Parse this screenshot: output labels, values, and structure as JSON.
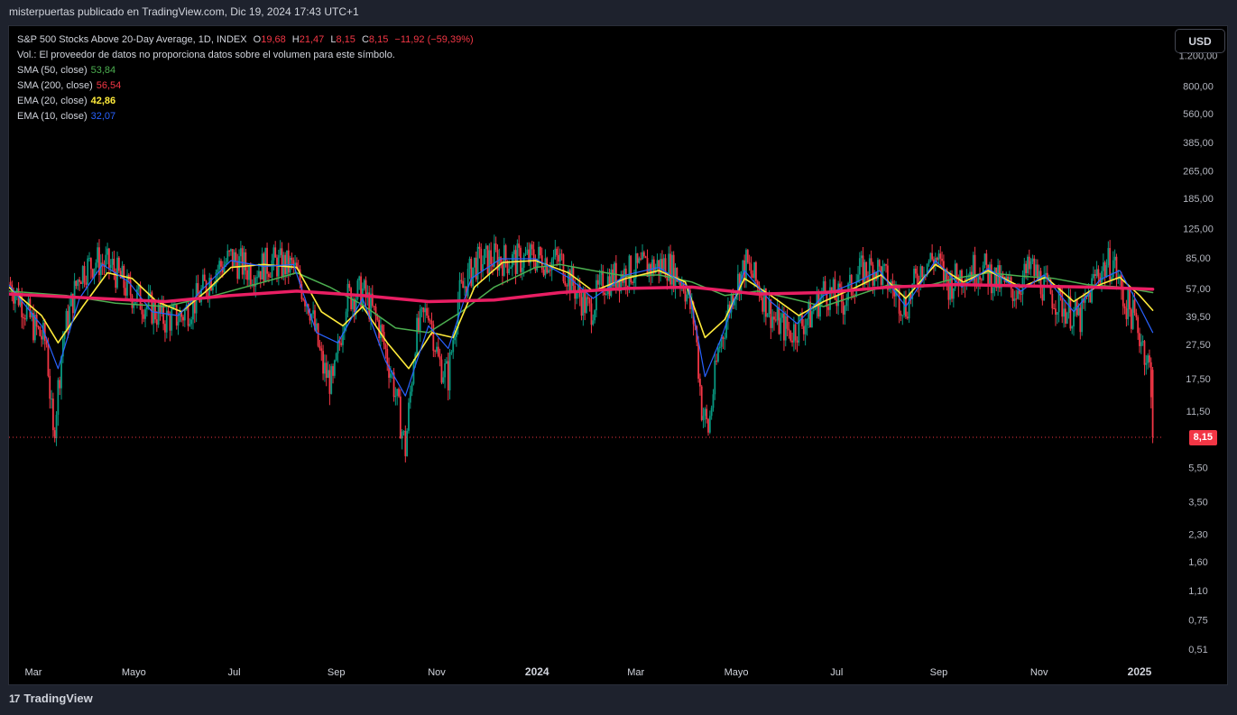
{
  "header": {
    "publish_line": "misterpuertas publicado en TradingView.com, Dic 19, 2024 17:43 UTC+1"
  },
  "footer": {
    "brand": "TradingView",
    "logo_glyph": "17"
  },
  "currency_button": "USD",
  "legend": {
    "symbol": "S&P 500 Stocks Above 20-Day Average, 1D, INDEX",
    "o_label": "O",
    "o_value": "19,68",
    "h_label": "H",
    "h_value": "21,47",
    "l_label": "L",
    "l_value": "8,15",
    "c_label": "C",
    "c_value": "8,15",
    "change": "−11,92 (−59,39%)",
    "volume_note": "Vol.: El proveedor de datos no proporciona datos sobre el volumen para este símbolo.",
    "indicators": [
      {
        "label": "SMA (50, close)",
        "value": "53,84",
        "color": "#4caf50"
      },
      {
        "label": "SMA (200, close)",
        "value": "56,54",
        "color": "#f23645"
      },
      {
        "label": "EMA (20, close)",
        "value": "42,86",
        "color": "#ffeb3b"
      },
      {
        "label": "EMA (10, close)",
        "value": "32,07",
        "color": "#2962ff"
      }
    ]
  },
  "colors": {
    "up": "#089981",
    "down": "#f23645",
    "sma50": "#4caf50",
    "sma200": "#e91e63",
    "ema20": "#ffeb3b",
    "ema10": "#2962ff"
  },
  "current_price_label": "8,15",
  "chart_data": {
    "type": "candlestick",
    "scale": "log",
    "title": "S&P 500 Stocks Above 20-Day Average, 1D, INDEX",
    "y_ticks": [
      "1.200,00",
      "800,00",
      "560,00",
      "385,00",
      "265,00",
      "185,00",
      "125,00",
      "85,00",
      "57,00",
      "39,50",
      "27,50",
      "17,50",
      "11,50",
      "8,15",
      "5,50",
      "3,50",
      "2,30",
      "1,60",
      "1,10",
      "0,75",
      "0,51"
    ],
    "y_tick_values": [
      1200,
      800,
      560,
      385,
      265,
      185,
      125,
      85,
      57,
      39.5,
      27.5,
      17.5,
      11.5,
      8.15,
      5.5,
      3.5,
      2.3,
      1.6,
      1.1,
      0.75,
      0.51
    ],
    "ylim": [
      0.45,
      1500
    ],
    "x_ticks": [
      {
        "label": "Mar",
        "day": 0
      },
      {
        "label": "Mayo",
        "day": 61
      },
      {
        "label": "Jul",
        "day": 122
      },
      {
        "label": "Sep",
        "day": 184
      },
      {
        "label": "Nov",
        "day": 245
      },
      {
        "label": "2024",
        "day": 306
      },
      {
        "label": "Mar",
        "day": 366
      },
      {
        "label": "Mayo",
        "day": 427
      },
      {
        "label": "Jul",
        "day": 488
      },
      {
        "label": "Sep",
        "day": 550
      },
      {
        "label": "Nov",
        "day": 611
      },
      {
        "label": "2025",
        "day": 672
      }
    ],
    "x_range": [
      -15,
      700
    ],
    "close_series": [
      {
        "day": -15,
        "v": 62
      },
      {
        "day": -8,
        "v": 50
      },
      {
        "day": 0,
        "v": 35
      },
      {
        "day": 8,
        "v": 28
      },
      {
        "day": 12,
        "v": 8
      },
      {
        "day": 18,
        "v": 30
      },
      {
        "day": 28,
        "v": 70
      },
      {
        "day": 38,
        "v": 82
      },
      {
        "day": 48,
        "v": 75
      },
      {
        "day": 58,
        "v": 55
      },
      {
        "day": 70,
        "v": 45
      },
      {
        "day": 80,
        "v": 38
      },
      {
        "day": 90,
        "v": 40
      },
      {
        "day": 100,
        "v": 50
      },
      {
        "day": 110,
        "v": 72
      },
      {
        "day": 120,
        "v": 85
      },
      {
        "day": 132,
        "v": 72
      },
      {
        "day": 145,
        "v": 80
      },
      {
        "day": 158,
        "v": 75
      },
      {
        "day": 168,
        "v": 45
      },
      {
        "day": 176,
        "v": 20
      },
      {
        "day": 182,
        "v": 16
      },
      {
        "day": 190,
        "v": 50
      },
      {
        "day": 200,
        "v": 55
      },
      {
        "day": 210,
        "v": 35
      },
      {
        "day": 218,
        "v": 18
      },
      {
        "day": 226,
        "v": 7
      },
      {
        "day": 232,
        "v": 30
      },
      {
        "day": 240,
        "v": 45
      },
      {
        "day": 246,
        "v": 22
      },
      {
        "day": 252,
        "v": 18
      },
      {
        "day": 258,
        "v": 50
      },
      {
        "day": 268,
        "v": 78
      },
      {
        "day": 280,
        "v": 85
      },
      {
        "day": 292,
        "v": 82
      },
      {
        "day": 305,
        "v": 85
      },
      {
        "day": 320,
        "v": 82
      },
      {
        "day": 330,
        "v": 55
      },
      {
        "day": 338,
        "v": 42
      },
      {
        "day": 346,
        "v": 62
      },
      {
        "day": 360,
        "v": 70
      },
      {
        "day": 372,
        "v": 75
      },
      {
        "day": 385,
        "v": 78
      },
      {
        "day": 395,
        "v": 62
      },
      {
        "day": 402,
        "v": 35
      },
      {
        "day": 406,
        "v": 12
      },
      {
        "day": 410,
        "v": 9
      },
      {
        "day": 416,
        "v": 25
      },
      {
        "day": 425,
        "v": 55
      },
      {
        "day": 433,
        "v": 78
      },
      {
        "day": 442,
        "v": 55
      },
      {
        "day": 450,
        "v": 38
      },
      {
        "day": 460,
        "v": 32
      },
      {
        "day": 472,
        "v": 40
      },
      {
        "day": 480,
        "v": 55
      },
      {
        "day": 492,
        "v": 48
      },
      {
        "day": 502,
        "v": 70
      },
      {
        "day": 512,
        "v": 75
      },
      {
        "day": 520,
        "v": 60
      },
      {
        "day": 530,
        "v": 45
      },
      {
        "day": 540,
        "v": 78
      },
      {
        "day": 548,
        "v": 85
      },
      {
        "day": 556,
        "v": 60
      },
      {
        "day": 566,
        "v": 72
      },
      {
        "day": 576,
        "v": 75
      },
      {
        "day": 586,
        "v": 62
      },
      {
        "day": 596,
        "v": 55
      },
      {
        "day": 606,
        "v": 75
      },
      {
        "day": 616,
        "v": 55
      },
      {
        "day": 626,
        "v": 45
      },
      {
        "day": 636,
        "v": 38
      },
      {
        "day": 646,
        "v": 70
      },
      {
        "day": 656,
        "v": 82
      },
      {
        "day": 662,
        "v": 50
      },
      {
        "day": 668,
        "v": 40
      },
      {
        "day": 674,
        "v": 28
      },
      {
        "day": 678,
        "v": 20
      },
      {
        "day": 680,
        "v": 8.15
      }
    ],
    "sma50": [
      {
        "day": -15,
        "v": 55
      },
      {
        "day": 20,
        "v": 52
      },
      {
        "day": 50,
        "v": 47
      },
      {
        "day": 80,
        "v": 45
      },
      {
        "day": 110,
        "v": 52
      },
      {
        "day": 140,
        "v": 62
      },
      {
        "day": 160,
        "v": 70
      },
      {
        "day": 180,
        "v": 58
      },
      {
        "day": 200,
        "v": 46
      },
      {
        "day": 220,
        "v": 34
      },
      {
        "day": 240,
        "v": 32
      },
      {
        "day": 260,
        "v": 42
      },
      {
        "day": 280,
        "v": 58
      },
      {
        "day": 305,
        "v": 75
      },
      {
        "day": 320,
        "v": 78
      },
      {
        "day": 340,
        "v": 72
      },
      {
        "day": 360,
        "v": 67
      },
      {
        "day": 380,
        "v": 68
      },
      {
        "day": 400,
        "v": 62
      },
      {
        "day": 420,
        "v": 52
      },
      {
        "day": 440,
        "v": 55
      },
      {
        "day": 460,
        "v": 50
      },
      {
        "day": 480,
        "v": 45
      },
      {
        "day": 500,
        "v": 52
      },
      {
        "day": 520,
        "v": 60
      },
      {
        "day": 540,
        "v": 58
      },
      {
        "day": 560,
        "v": 65
      },
      {
        "day": 580,
        "v": 70
      },
      {
        "day": 600,
        "v": 67
      },
      {
        "day": 620,
        "v": 65
      },
      {
        "day": 640,
        "v": 60
      },
      {
        "day": 660,
        "v": 58
      },
      {
        "day": 680,
        "v": 54
      }
    ],
    "sma200": [
      {
        "day": -15,
        "v": 53
      },
      {
        "day": 40,
        "v": 50
      },
      {
        "day": 80,
        "v": 48
      },
      {
        "day": 120,
        "v": 52
      },
      {
        "day": 160,
        "v": 55
      },
      {
        "day": 200,
        "v": 52
      },
      {
        "day": 240,
        "v": 48
      },
      {
        "day": 280,
        "v": 49
      },
      {
        "day": 320,
        "v": 54
      },
      {
        "day": 360,
        "v": 57
      },
      {
        "day": 400,
        "v": 58
      },
      {
        "day": 440,
        "v": 53
      },
      {
        "day": 480,
        "v": 54
      },
      {
        "day": 520,
        "v": 58
      },
      {
        "day": 560,
        "v": 60
      },
      {
        "day": 600,
        "v": 59
      },
      {
        "day": 640,
        "v": 58
      },
      {
        "day": 680,
        "v": 56.5
      }
    ],
    "ema20": [
      {
        "day": -15,
        "v": 58
      },
      {
        "day": 5,
        "v": 40
      },
      {
        "day": 15,
        "v": 28
      },
      {
        "day": 30,
        "v": 45
      },
      {
        "day": 45,
        "v": 70
      },
      {
        "day": 60,
        "v": 65
      },
      {
        "day": 75,
        "v": 48
      },
      {
        "day": 90,
        "v": 42
      },
      {
        "day": 105,
        "v": 55
      },
      {
        "day": 120,
        "v": 75
      },
      {
        "day": 140,
        "v": 78
      },
      {
        "day": 160,
        "v": 75
      },
      {
        "day": 175,
        "v": 42
      },
      {
        "day": 188,
        "v": 35
      },
      {
        "day": 200,
        "v": 45
      },
      {
        "day": 215,
        "v": 28
      },
      {
        "day": 228,
        "v": 20
      },
      {
        "day": 242,
        "v": 32
      },
      {
        "day": 255,
        "v": 30
      },
      {
        "day": 268,
        "v": 58
      },
      {
        "day": 285,
        "v": 80
      },
      {
        "day": 305,
        "v": 82
      },
      {
        "day": 325,
        "v": 70
      },
      {
        "day": 340,
        "v": 55
      },
      {
        "day": 360,
        "v": 65
      },
      {
        "day": 380,
        "v": 72
      },
      {
        "day": 396,
        "v": 62
      },
      {
        "day": 408,
        "v": 30
      },
      {
        "day": 420,
        "v": 38
      },
      {
        "day": 432,
        "v": 65
      },
      {
        "day": 448,
        "v": 52
      },
      {
        "day": 465,
        "v": 40
      },
      {
        "day": 480,
        "v": 48
      },
      {
        "day": 500,
        "v": 58
      },
      {
        "day": 515,
        "v": 68
      },
      {
        "day": 530,
        "v": 50
      },
      {
        "day": 548,
        "v": 78
      },
      {
        "day": 565,
        "v": 62
      },
      {
        "day": 580,
        "v": 72
      },
      {
        "day": 600,
        "v": 58
      },
      {
        "day": 615,
        "v": 66
      },
      {
        "day": 632,
        "v": 48
      },
      {
        "day": 648,
        "v": 60
      },
      {
        "day": 660,
        "v": 66
      },
      {
        "day": 672,
        "v": 52
      },
      {
        "day": 680,
        "v": 42.86
      }
    ],
    "ema10": [
      {
        "day": -15,
        "v": 60
      },
      {
        "day": 5,
        "v": 35
      },
      {
        "day": 15,
        "v": 20
      },
      {
        "day": 28,
        "v": 50
      },
      {
        "day": 42,
        "v": 78
      },
      {
        "day": 58,
        "v": 62
      },
      {
        "day": 72,
        "v": 42
      },
      {
        "day": 88,
        "v": 40
      },
      {
        "day": 104,
        "v": 58
      },
      {
        "day": 120,
        "v": 82
      },
      {
        "day": 140,
        "v": 76
      },
      {
        "day": 158,
        "v": 78
      },
      {
        "day": 172,
        "v": 32
      },
      {
        "day": 185,
        "v": 28
      },
      {
        "day": 200,
        "v": 50
      },
      {
        "day": 214,
        "v": 22
      },
      {
        "day": 226,
        "v": 14
      },
      {
        "day": 240,
        "v": 35
      },
      {
        "day": 252,
        "v": 26
      },
      {
        "day": 266,
        "v": 65
      },
      {
        "day": 284,
        "v": 84
      },
      {
        "day": 305,
        "v": 84
      },
      {
        "day": 326,
        "v": 65
      },
      {
        "day": 340,
        "v": 50
      },
      {
        "day": 360,
        "v": 68
      },
      {
        "day": 380,
        "v": 75
      },
      {
        "day": 398,
        "v": 58
      },
      {
        "day": 408,
        "v": 18
      },
      {
        "day": 418,
        "v": 30
      },
      {
        "day": 432,
        "v": 72
      },
      {
        "day": 448,
        "v": 48
      },
      {
        "day": 464,
        "v": 36
      },
      {
        "day": 480,
        "v": 52
      },
      {
        "day": 500,
        "v": 62
      },
      {
        "day": 514,
        "v": 72
      },
      {
        "day": 530,
        "v": 45
      },
      {
        "day": 548,
        "v": 82
      },
      {
        "day": 564,
        "v": 58
      },
      {
        "day": 580,
        "v": 74
      },
      {
        "day": 600,
        "v": 55
      },
      {
        "day": 614,
        "v": 68
      },
      {
        "day": 632,
        "v": 42
      },
      {
        "day": 648,
        "v": 64
      },
      {
        "day": 660,
        "v": 72
      },
      {
        "day": 672,
        "v": 45
      },
      {
        "day": 680,
        "v": 32.07
      }
    ]
  }
}
